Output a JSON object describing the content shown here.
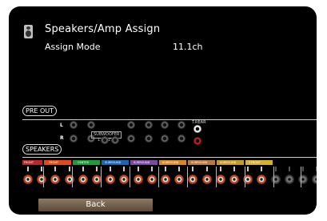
{
  "header": {
    "title": "Speakers/Amp Assign",
    "mode_label": "Assign Mode",
    "mode_value": "11.1ch"
  },
  "sections": {
    "preout": "PRE OUT",
    "speakers": "SPEAKERS"
  },
  "preout": {
    "left_tag": "L",
    "right_tag": "R",
    "subwoofer_label": "SUBWOOFER",
    "sub_numbers": [
      "1",
      "2"
    ],
    "tfront_label": "T.REAR"
  },
  "speaker_strips": [
    {
      "label": "FRONT",
      "color": "#b8282a"
    },
    {
      "label": "FRONT",
      "color": "#e04a1a"
    },
    {
      "label": "CENTER",
      "color": "#1e9a3a"
    },
    {
      "label": "SURROUND",
      "color": "#1e64b4"
    },
    {
      "label": "SURROUND",
      "color": "#7a4aa0"
    },
    {
      "label": "SURROUND",
      "color": "#d6882a"
    },
    {
      "label": "SURROUND",
      "color": "#b87a40"
    },
    {
      "label": "SURROUND",
      "color": "#c69a2a"
    },
    {
      "label": "T.FRONT",
      "color": "#d8b030"
    }
  ],
  "back_button": "Back"
}
